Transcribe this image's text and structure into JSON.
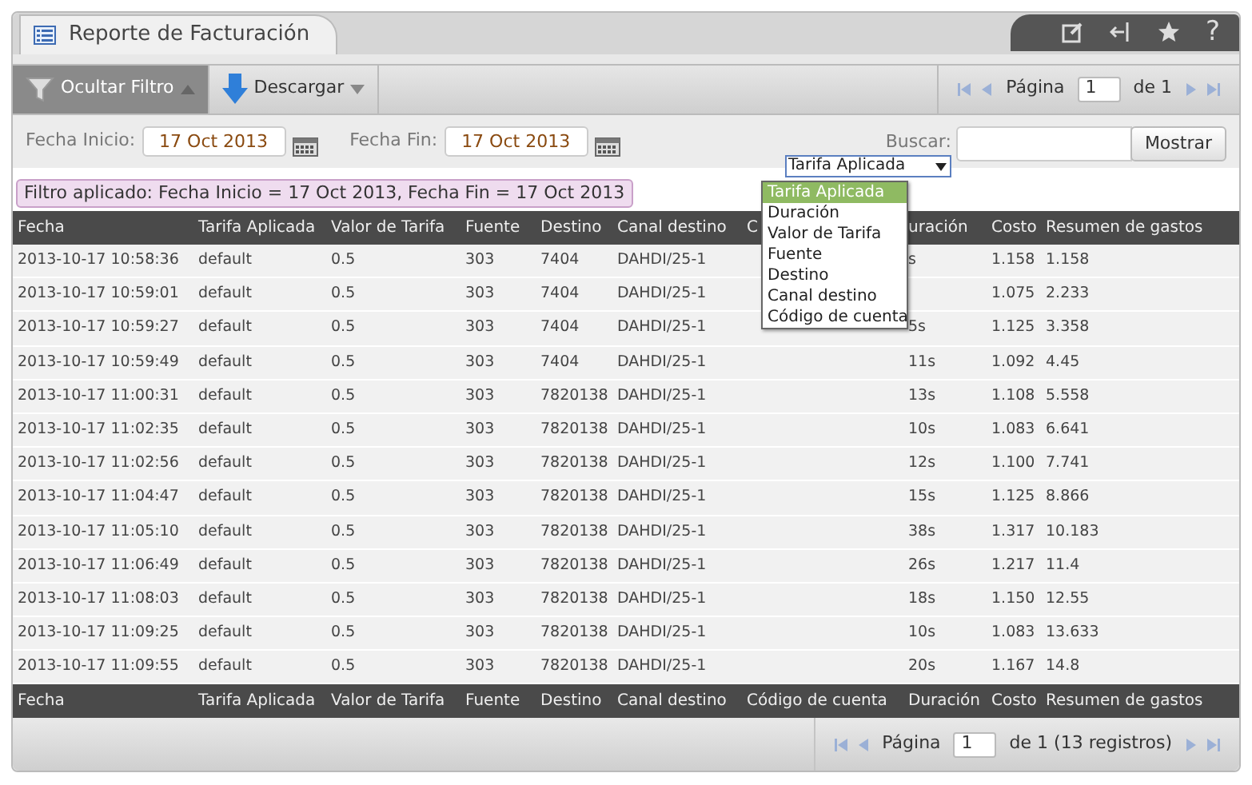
{
  "window": {
    "title": "Reporte de Facturación",
    "help": "?"
  },
  "toolbar": {
    "filter_button": {
      "label": "Ocultar Filtro",
      "selected": true
    },
    "download_button": {
      "label": "Descargar"
    },
    "pager": {
      "label": "Página",
      "page": "1",
      "of": "de 1"
    }
  },
  "filter": {
    "start_label": "Fecha Inicio:",
    "start_value": "17 Oct 2013",
    "end_label": "Fecha Fin:",
    "end_value": "17 Oct 2013",
    "search_label": "Buscar:",
    "search_field": "Tarifa Aplicada",
    "search_button": "Mostrar",
    "applied": "Filtro aplicado: Fecha Inicio = 17 Oct 2013, Fecha Fin = 17 Oct 2013"
  },
  "search_field_options": [
    {
      "label": "Tarifa Aplicada",
      "selected": true
    },
    {
      "label": "Duración",
      "selected": false
    },
    {
      "label": "Valor de Tarifa",
      "selected": false
    },
    {
      "label": "Fuente",
      "selected": false
    },
    {
      "label": "Destino",
      "selected": false
    },
    {
      "label": "Canal destino",
      "selected": false
    },
    {
      "label": "Código de cuenta",
      "selected": false
    }
  ],
  "table": {
    "columns": [
      "Fecha",
      "Tarifa Aplicada",
      "Valor de Tarifa",
      "Fuente",
      "Destino",
      "Canal destino",
      "C",
      "uración",
      "Costo",
      "Resumen de gastos"
    ],
    "rows": [
      {
        "fecha": "2013-10-17 10:58:36",
        "tarifa": "default",
        "valor": "0.5",
        "fuente": "303",
        "destino": "7404",
        "canal": "DAHDI/25-1",
        "duracion": "s",
        "costo": "1.158",
        "resumen": "1.158"
      },
      {
        "fecha": "2013-10-17 10:59:01",
        "tarifa": "default",
        "valor": "0.5",
        "fuente": "303",
        "destino": "7404",
        "canal": "DAHDI/25-1",
        "costo": "1.075",
        "resumen": "2.233"
      },
      {
        "fecha": "2013-10-17 10:59:27",
        "tarifa": "default",
        "valor": "0.5",
        "fuente": "303",
        "destino": "7404",
        "canal": "DAHDI/25-1",
        "duracion": "5s",
        "costo": "1.125",
        "resumen": "3.358"
      },
      {
        "fecha": "2013-10-17 10:59:49",
        "tarifa": "default",
        "valor": "0.5",
        "fuente": "303",
        "destino": "7404",
        "canal": "DAHDI/25-1",
        "duracion": "11s",
        "costo": "1.092",
        "resumen": "4.45"
      },
      {
        "fecha": "2013-10-17 11:00:31",
        "tarifa": "default",
        "valor": "0.5",
        "fuente": "303",
        "destino": "7820138",
        "canal": "DAHDI/25-1",
        "duracion": "13s",
        "costo": "1.108",
        "resumen": "5.558"
      },
      {
        "fecha": "2013-10-17 11:02:35",
        "tarifa": "default",
        "valor": "0.5",
        "fuente": "303",
        "destino": "7820138",
        "canal": "DAHDI/25-1",
        "duracion": "10s",
        "costo": "1.083",
        "resumen": "6.641"
      },
      {
        "fecha": "2013-10-17 11:02:56",
        "tarifa": "default",
        "valor": "0.5",
        "fuente": "303",
        "destino": "7820138",
        "canal": "DAHDI/25-1",
        "duracion": "12s",
        "costo": "1.100",
        "resumen": "7.741"
      },
      {
        "fecha": "2013-10-17 11:04:47",
        "tarifa": "default",
        "valor": "0.5",
        "fuente": "303",
        "destino": "7820138",
        "canal": "DAHDI/25-1",
        "duracion": "15s",
        "costo": "1.125",
        "resumen": "8.866"
      },
      {
        "fecha": "2013-10-17 11:05:10",
        "tarifa": "default",
        "valor": "0.5",
        "fuente": "303",
        "destino": "7820138",
        "canal": "DAHDI/25-1",
        "duracion": "38s",
        "costo": "1.317",
        "resumen": "10.183"
      },
      {
        "fecha": "2013-10-17 11:06:49",
        "tarifa": "default",
        "valor": "0.5",
        "fuente": "303",
        "destino": "7820138",
        "canal": "DAHDI/25-1",
        "duracion": "26s",
        "costo": "1.217",
        "resumen": "11.4"
      },
      {
        "fecha": "2013-10-17 11:08:03",
        "tarifa": "default",
        "valor": "0.5",
        "fuente": "303",
        "destino": "7820138",
        "canal": "DAHDI/25-1",
        "duracion": "18s",
        "costo": "1.150",
        "resumen": "12.55"
      },
      {
        "fecha": "2013-10-17 11:09:25",
        "tarifa": "default",
        "valor": "0.5",
        "fuente": "303",
        "destino": "7820138",
        "canal": "DAHDI/25-1",
        "duracion": "10s",
        "costo": "1.083",
        "resumen": "13.633"
      },
      {
        "fecha": "2013-10-17 11:09:55",
        "tarifa": "default",
        "valor": "0.5",
        "fuente": "303",
        "destino": "7820138",
        "canal": "DAHDI/25-1",
        "duracion": "20s",
        "costo": "1.167",
        "resumen": "14.8"
      }
    ],
    "footer_columns": [
      "Fecha",
      "Tarifa Aplicada",
      "Valor de Tarifa",
      "Fuente",
      "Destino",
      "Canal destino",
      "Código de cuenta",
      "Duración",
      "Costo",
      "Resumen de gastos"
    ]
  },
  "bottom_pager": {
    "label": "Página",
    "page": "1",
    "of": "de 1 (13 registros)"
  }
}
